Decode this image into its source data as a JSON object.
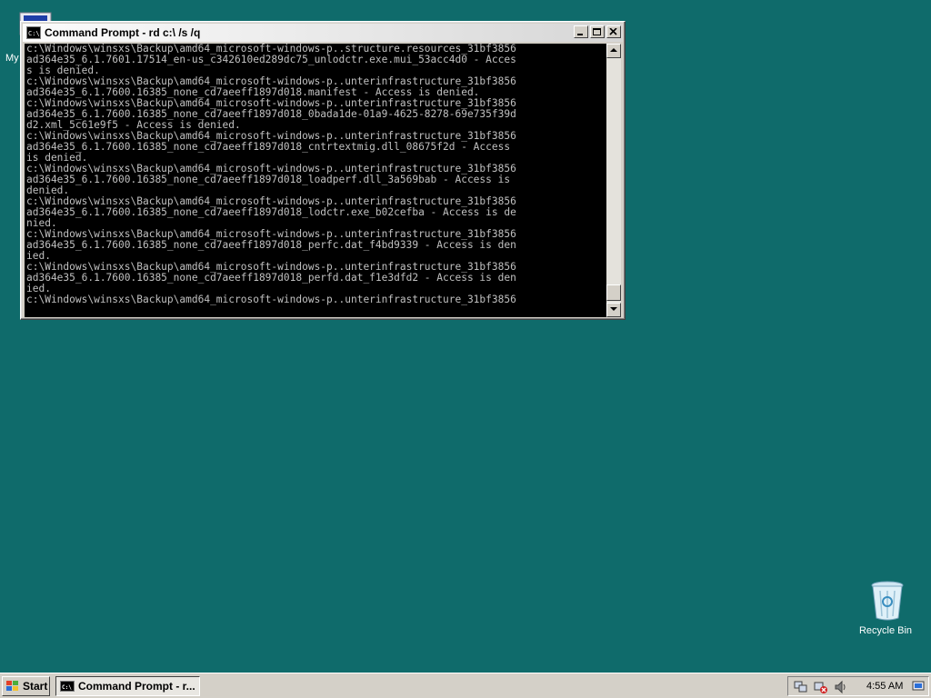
{
  "desktop": {
    "my_computer_label": "My",
    "recycle_bin_label": "Recycle Bin"
  },
  "window": {
    "title": "Command Prompt - rd  c:\\ /s /q",
    "console_lines": [
      "c:\\Windows\\winsxs\\Backup\\amd64_microsoft-windows-p..structure.resources_31bf3856",
      "ad364e35_6.1.7601.17514_en-us_c342610ed289dc75_unlodctr.exe.mui_53acc4d0 - Acces",
      "s is denied.",
      "c:\\Windows\\winsxs\\Backup\\amd64_microsoft-windows-p..unterinfrastructure_31bf3856",
      "ad364e35_6.1.7600.16385_none_cd7aeeff1897d018.manifest - Access is denied.",
      "c:\\Windows\\winsxs\\Backup\\amd64_microsoft-windows-p..unterinfrastructure_31bf3856",
      "ad364e35_6.1.7600.16385_none_cd7aeeff1897d018_0bada1de-01a9-4625-8278-69e735f39d",
      "d2.xml_5c61e9f5 - Access is denied.",
      "c:\\Windows\\winsxs\\Backup\\amd64_microsoft-windows-p..unterinfrastructure_31bf3856",
      "ad364e35_6.1.7600.16385_none_cd7aeeff1897d018_cntrtextmig.dll_08675f2d - Access",
      "is denied.",
      "c:\\Windows\\winsxs\\Backup\\amd64_microsoft-windows-p..unterinfrastructure_31bf3856",
      "ad364e35_6.1.7600.16385_none_cd7aeeff1897d018_loadperf.dll_3a569bab - Access is",
      "denied.",
      "c:\\Windows\\winsxs\\Backup\\amd64_microsoft-windows-p..unterinfrastructure_31bf3856",
      "ad364e35_6.1.7600.16385_none_cd7aeeff1897d018_lodctr.exe_b02cefba - Access is de",
      "nied.",
      "c:\\Windows\\winsxs\\Backup\\amd64_microsoft-windows-p..unterinfrastructure_31bf3856",
      "ad364e35_6.1.7600.16385_none_cd7aeeff1897d018_perfc.dat_f4bd9339 - Access is den",
      "ied.",
      "c:\\Windows\\winsxs\\Backup\\amd64_microsoft-windows-p..unterinfrastructure_31bf3856",
      "ad364e35_6.1.7600.16385_none_cd7aeeff1897d018_perfd.dat_f1e3dfd2 - Access is den",
      "ied.",
      "c:\\Windows\\winsxs\\Backup\\amd64_microsoft-windows-p..unterinfrastructure_31bf3856"
    ]
  },
  "taskbar": {
    "start_label": "Start",
    "task_label": "Command Prompt - r...",
    "clock": "4:55 AM"
  },
  "colors": {
    "desktop": "#0f6b6b",
    "console_bg": "#000000",
    "console_fg": "#c0c0c0"
  }
}
